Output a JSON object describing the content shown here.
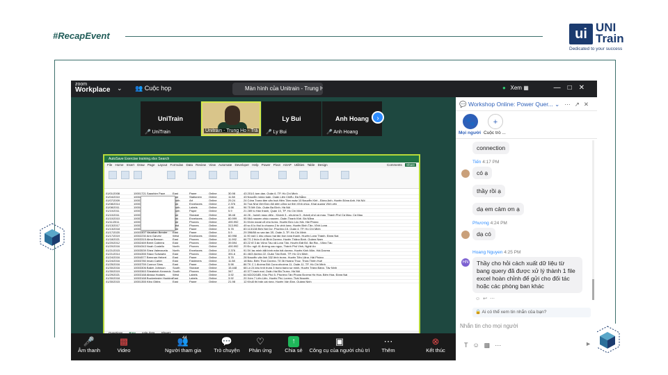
{
  "slide": {
    "hashtag": "#RecapEvent",
    "logo": {
      "mark": "ui",
      "brand_line1": "UNI",
      "brand_line2": "Train",
      "tagline": "Dedicated to your success"
    }
  },
  "zoom": {
    "app_logo_small": "zoom",
    "app_logo_big": "Workplace",
    "meeting_label": "Cuộc họp",
    "share_tab": "Màn hình của Unitrain - Trung Hi",
    "view_label": "Xem",
    "participants": [
      {
        "name": "UniTrain",
        "label": "UniTrain"
      },
      {
        "name": "",
        "label": "Unitrain - Trung Ho - Trả"
      },
      {
        "name": "Ly Bui",
        "label": "Ly Bui"
      },
      {
        "name": "Anh Hoang",
        "label": "Anh Hoang"
      }
    ],
    "excel": {
      "title": "AutoSave  Exercise training.xlsx  Search",
      "menu": "File Home Insert Draw Page Layout Formulas Data Review View Automate Developer Help Power Pivot ASAP Utilities Table Design",
      "comments": "Comments",
      "share": "Share",
      "sheet_tabs": [
        "Questions",
        "Raw",
        "sale data",
        "Sheet1"
      ],
      "active_tab": "Raw",
      "rows": [
        [
          "01/01/2008",
          "10001721 Sapphire Pace",
          "East",
          "Paper",
          "Online",
          "30.98",
          "43 201/1 tom dan, Quận 6, TP. Hồ Chí Minh"
        ],
        [
          "01/04/2010",
          "10002740 Venus Finch",
          "East",
          "Stationery",
          "Online",
          "11.58",
          "43 Nguyễn mộng tuấn, Quận Liên Chiểu, Đà Nẵng"
        ],
        [
          "01/07/2009",
          "10003773 Harrison Barker",
          "South",
          "Art",
          "Online",
          "29.24",
          "24 Cống Trung tâm văn hoá Hiền Tâm ngày 10 Nguyễn Khê - Đồng Anh, Huyện Đông Anh, Hà Nội"
        ],
        [
          "01/08/2014",
          "10003539 Joseph Potts",
          "East",
          "Envelopes",
          "Online",
          "2.376",
          "34 Tòa Nhà Viet Đức đối diện cổng sơ tỉnh Vĩnh phúc, Khai quang Vĩnh yên"
        ],
        [
          "01/08/2011",
          "10004425 Velma Nichols",
          "South",
          "Labels",
          "Online",
          "4.98",
          "96 75 Mê Gốc, Quận Ba Đình, Hà Nội"
        ],
        [
          "01/10/2011",
          "10003997 Thane Hood",
          "South",
          "Paper",
          "Online",
          "5.9",
          "21 289 tú Hàn thành, Quận 10, TP. Hồ Chí Minh"
        ],
        [
          "01/10/2011",
          "10003361 Victor Suarez",
          "East",
          "Storage",
          "Online",
          "38.48",
          "44 26 - huỳnh ngọc diệp - Khánh 3 - phường 5 - thành phố cà mau, Thành Phố Cà Mau, Cà Mau"
        ],
        [
          "01/10/2010",
          "10003250 Yoshi Ruiz",
          "East",
          "Envelopes",
          "Online",
          "60.999",
          "95 564 nguyen phúc nguyen, Quận Thanh Khê, Đà Nẵng"
        ],
        [
          "01/11/2011",
          "10003341 Quail Knox",
          "East",
          "Phones",
          "Online",
          "490.992",
          "31 Khôn ngoài cổ phú hưng, Huyện Đức Lộc Hải, Hải Phòng"
        ],
        [
          "01/13/2017",
          "10003619 Tana Velazquez",
          "West",
          "Phones",
          "Online",
          "313.992",
          "49 so 6 lo thui lo phuong 2 tp vinh long, Huyện Bình Tân, Vĩnh Long"
        ],
        [
          "01/13/2018",
          "10003377 Melinda Klein",
          "East",
          "Paper",
          "Online",
          "5.78",
          "83 113/138 Bến Nội Dơ, Phường 15, Quận 4, TP. Hồ Chí Minh"
        ],
        [
          "01/17/2020",
          "10003307 Vaughan Bender",
          "East",
          "Paper",
          "Online",
          "5.9",
          "29 396/88 xo van tan 3S, Quận 3, TP. Hồ Chí Minh"
        ],
        [
          "01/17/2019",
          "10002230 Ann Garvey",
          "West",
          "Envelopes",
          "Online",
          "60.998",
          "11 90 ngõ 1 khu phuoc hai tân tron long thanh, Huyện Long Thành, Đồng Nai"
        ],
        [
          "01/18/2021",
          "10003315 Alma Benson",
          "East",
          "Phones",
          "Online",
          "11.992",
          "66 TS 2 thôn 6 xã Bình Dương, Huyện Thăng Bình, Quảng Nam"
        ],
        [
          "01/20/2012",
          "10002469 Brent Cabrera",
          "East",
          "Phones",
          "Online",
          "39.594",
          "83 22 tổ 3 ấp Vũng Tàu xã Long Tân, Huyện Đất Đỏ, Bà Rịa - Vũng Tàu"
        ],
        [
          "01/20/2016",
          "10004343 Noah Costello",
          "North",
          "Phones",
          "Online",
          "490.992",
          "20 Đc: ngõ 41 đường cao ngọc, Thành Phố Vinh, Nghệ An"
        ],
        [
          "01/21/2015",
          "10003539 Shea Valenzuela",
          "North",
          "Envelopes",
          "Online",
          "2.376",
          "91 5V lạc minh bắt bình mân hải dương, Huyện Kinh Môn, Hải Dương"
        ],
        [
          "01/21/2014",
          "10004355 Stacy Schwartz",
          "East",
          "Phones",
          "Online",
          "391.6",
          "81 46/3 đường 22, Quận Tân Bình, TP. Hồ Chí Minh"
        ],
        [
          "01/24/2016",
          "10004577 Brennan Hebert",
          "East",
          "Paper",
          "Online",
          "5.78",
          "28 Nguyễn văn linh 332 lệnh trưng, Huyện Tiên Lãng, Hải Phòng"
        ],
        [
          "01/24/2016",
          "10003780 Inyan Carter",
          "East",
          "Fasteners",
          "Online",
          "11.58",
          "18 Bảo, Biên Thuỷ Dương, Tổ 36 Hoàng Thuỵ, Thừa Thiên Huế"
        ],
        [
          "01/25/2016",
          "10003759 Connor Sims",
          "East",
          "Paper",
          "Online",
          "5.98",
          "86 TK C 1 đường Đội Cung phường 11, Quận 11, TP. Hồ Chí Minh"
        ],
        [
          "01/30/2016",
          "10003306 Baker Johnson",
          "South",
          "Storage",
          "Online",
          "15.448",
          "68 Lô 24 khu tình trung 3 trung bạng sự minh, Huyện Trảng Bàng, Tây Ninh"
        ],
        [
          "01/30/2019",
          "10003363 Shealeigh Kennedy",
          "South",
          "Phones",
          "Online",
          "347",
          "40 377 bạch mai, Quận Hai Bà Trưng, Hà Nội"
        ],
        [
          "01/29/2021",
          "10003168 Alyssa Hodges",
          "West",
          "Labels",
          "Online",
          "3.92",
          "64 M2/20/18B. Khu Phố 5, Phường Tân Phong Đường Hồ Hòa, Biên Hòa, Đồng Nai"
        ],
        [
          "01/30/2018",
          "10003168 Buckminster Hopkins",
          "East",
          "Labels",
          "Online",
          "3.92",
          "20 Xóm 7 Liên Liên, Huyện Phú Lương, Thái Nguyên"
        ],
        [
          "01/30/2015",
          "10001355 Kibo Gibbs",
          "East",
          "Paper",
          "Online",
          "21.98",
          "12 Khu5 thị trấn cái rồng, Huyện Vân Đồn, Quảng Ninh"
        ]
      ]
    },
    "toolbar": [
      {
        "icon": "mic-muted-icon",
        "label": "Âm thanh"
      },
      {
        "icon": "video-off-icon",
        "label": "Video"
      },
      {
        "icon": "participants-icon",
        "label": "Người tham gia",
        "count": "44"
      },
      {
        "icon": "chat-icon",
        "label": "Trò chuyện"
      },
      {
        "icon": "reaction-icon",
        "label": "Phản ứng"
      },
      {
        "icon": "share-icon",
        "label": "Chia sẻ"
      },
      {
        "icon": "apps-icon",
        "label": "Công cụ của người chủ trì"
      },
      {
        "icon": "more-icon",
        "label": "Thêm"
      },
      {
        "icon": "end-icon",
        "label": "Kết thúc"
      }
    ],
    "chat": {
      "title": "Workshop Online: Power Quer...",
      "tabs": [
        {
          "label": "Mọi người"
        },
        {
          "label": "Cuộc trò ..."
        }
      ],
      "messages": [
        {
          "text": "connection"
        },
        {
          "sender": "Tiến",
          "time": "4:17 PM",
          "text": "có ạ"
        },
        {
          "text": "thầy rồi ạ"
        },
        {
          "text": "dạ em cảm ơn ạ"
        },
        {
          "sender": "Phương",
          "time": "4:24 PM",
          "text": "dạ có"
        },
        {
          "sender": "Hoang Nguyen",
          "time": "4:25 PM",
          "initials": "HN",
          "text": "Thầy cho hỏi cách xuất dữ liệu từ bang query đã được xử lý thành 1 file excel hoàn chỉnh để gửi cho đối tác hoặc các phòng ban khác"
        }
      ],
      "who_can_see": "Ai có thể xem tin nhắn của bạn?",
      "input_placeholder": "Nhắn tin cho mọi người"
    }
  }
}
